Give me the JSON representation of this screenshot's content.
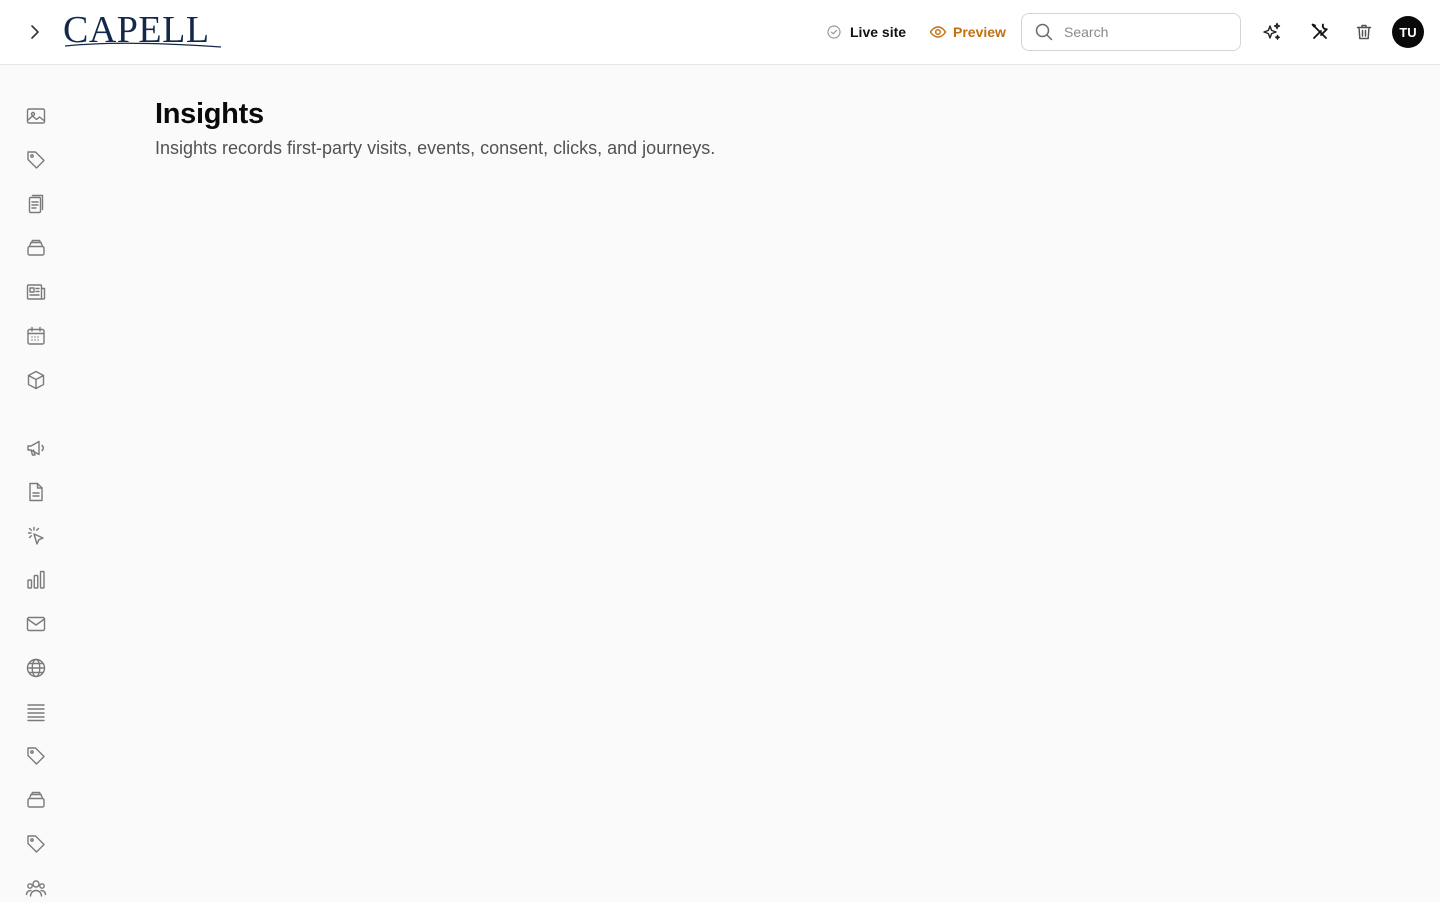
{
  "header": {
    "logo_text": "CAPELL",
    "live_site_label": "Live site",
    "preview_label": "Preview",
    "search_placeholder": "Search",
    "search_value": "",
    "avatar_initials": "TU",
    "preview_color": "#c2700f",
    "brand_color": "#14294a"
  },
  "main": {
    "title": "Insights",
    "description": "Insights records first-party visits, events, consent, clicks, and journeys."
  },
  "sidebar": {
    "items": [
      {
        "icon": "image-icon"
      },
      {
        "icon": "tag-icon"
      },
      {
        "icon": "clipboard-icon"
      },
      {
        "icon": "archive-icon"
      },
      {
        "icon": "newspaper-icon"
      },
      {
        "icon": "calendar-icon"
      },
      {
        "icon": "cube-icon"
      },
      {
        "icon": "megaphone-icon"
      },
      {
        "icon": "document-icon"
      },
      {
        "icon": "cursor-click-icon"
      },
      {
        "icon": "bar-chart-icon"
      },
      {
        "icon": "mail-icon"
      },
      {
        "icon": "globe-icon"
      },
      {
        "icon": "list-icon"
      },
      {
        "icon": "tag-icon"
      },
      {
        "icon": "archive-icon"
      },
      {
        "icon": "tag-icon"
      },
      {
        "icon": "users-icon"
      }
    ]
  }
}
